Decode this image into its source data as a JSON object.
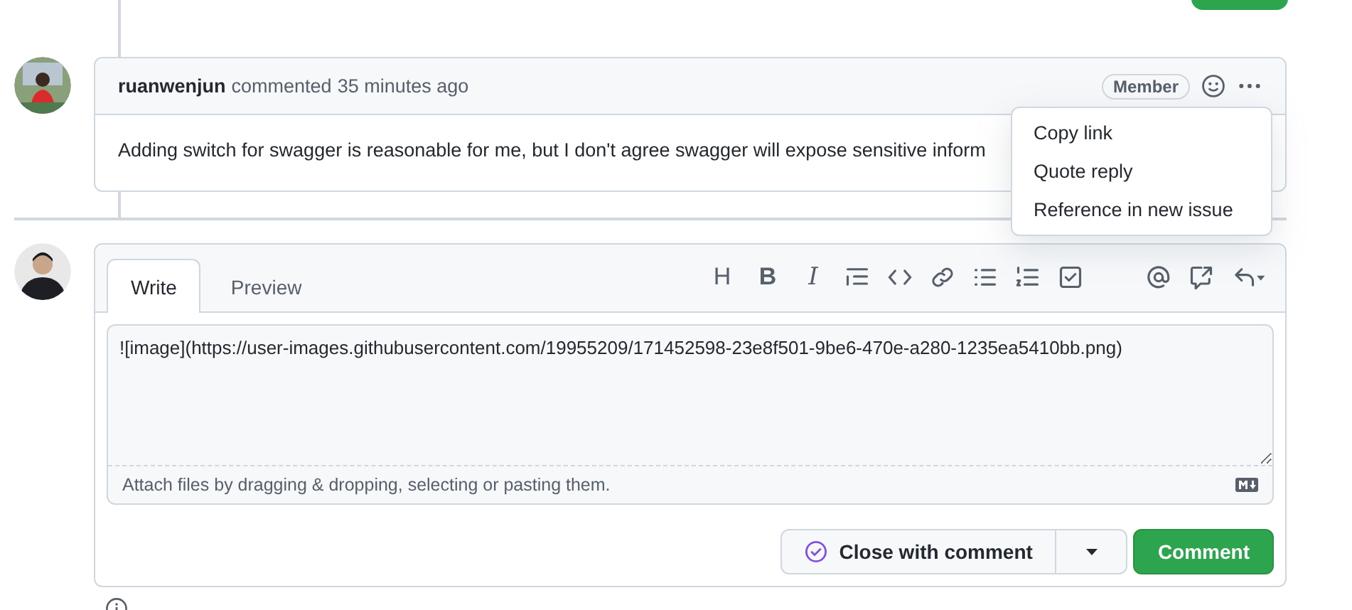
{
  "comment": {
    "author": "ruanwenjun",
    "action": "commented",
    "time": "35 minutes ago",
    "badge": "Member",
    "body": "Adding switch for swagger is reasonable for me, but I don't agree swagger will expose sensitive inform"
  },
  "comment_menu": {
    "items": [
      {
        "label": "Copy link"
      },
      {
        "label": "Quote reply"
      },
      {
        "label": "Reference in new issue"
      }
    ]
  },
  "editor": {
    "tabs": [
      {
        "label": "Write",
        "selected": true
      },
      {
        "label": "Preview",
        "selected": false
      }
    ],
    "toolbar": [
      {
        "kind": "text",
        "label": "H"
      },
      {
        "kind": "bold",
        "label": "B"
      },
      {
        "kind": "italic",
        "label": "I"
      },
      {
        "kind": "quote"
      },
      {
        "kind": "code"
      },
      {
        "kind": "link"
      },
      {
        "kind": "bullets"
      },
      {
        "kind": "numbers"
      },
      {
        "kind": "task"
      },
      {
        "kind": "gap"
      },
      {
        "kind": "mention"
      },
      {
        "kind": "reference"
      },
      {
        "kind": "reply"
      }
    ],
    "value": "![image](https://user-images.githubusercontent.com/19955209/171452598-23e8f501-9be6-470e-a280-1235ea5410bb.png)",
    "attach_hint": "Attach files by dragging & dropping, selecting or pasting them.",
    "buttons": [
      {
        "kind": "close",
        "label": "Close with comment"
      },
      {
        "kind": "submit",
        "label": "Comment"
      }
    ]
  }
}
